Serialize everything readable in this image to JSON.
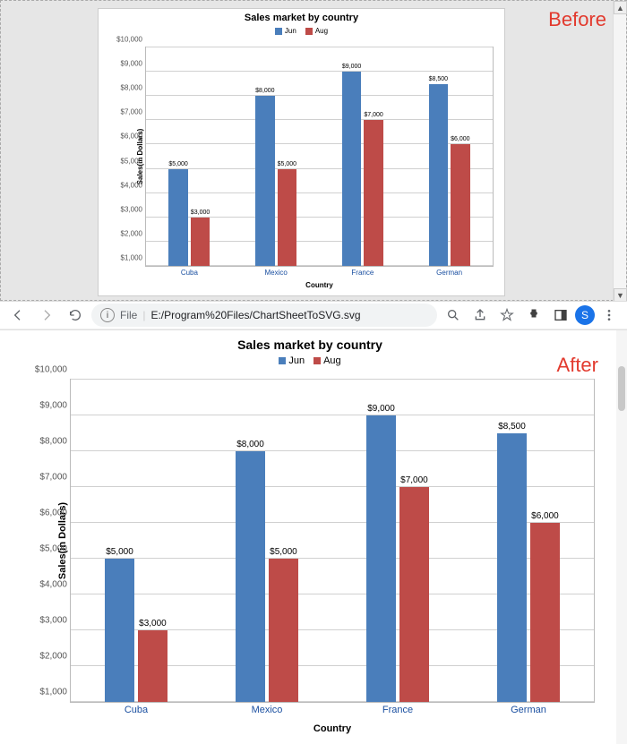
{
  "labels": {
    "before": "Before",
    "after": "After"
  },
  "browser": {
    "prefix": "File",
    "pipe": "|",
    "path": "E:/Program%20Files/ChartSheetToSVG.svg",
    "avatar_letter": "S"
  },
  "chart_data": {
    "type": "bar",
    "title": "Sales market by country",
    "xlabel": "Country",
    "ylabel": "Sales(in Dollars)",
    "categories": [
      "Cuba",
      "Mexico",
      "France",
      "German"
    ],
    "series": [
      {
        "name": "Jun",
        "color": "#4a7ebb",
        "values": [
          5000,
          8000,
          9000,
          8500
        ],
        "value_labels": [
          "$5,000",
          "$8,000",
          "$9,000",
          "$8,500"
        ]
      },
      {
        "name": "Aug",
        "color": "#be4b48",
        "values": [
          3000,
          5000,
          7000,
          6000
        ],
        "value_labels": [
          "$3,000",
          "$5,000",
          "$7,000",
          "$6,000"
        ]
      }
    ],
    "ylim": [
      1000,
      10000
    ],
    "yticks": [
      1000,
      2000,
      3000,
      4000,
      5000,
      6000,
      7000,
      8000,
      9000,
      10000
    ],
    "ytick_labels": [
      "$1,000",
      "$2,000",
      "$3,000",
      "$4,000",
      "$5,000",
      "$6,000",
      "$7,000",
      "$8,000",
      "$9,000",
      "$10,000"
    ]
  }
}
